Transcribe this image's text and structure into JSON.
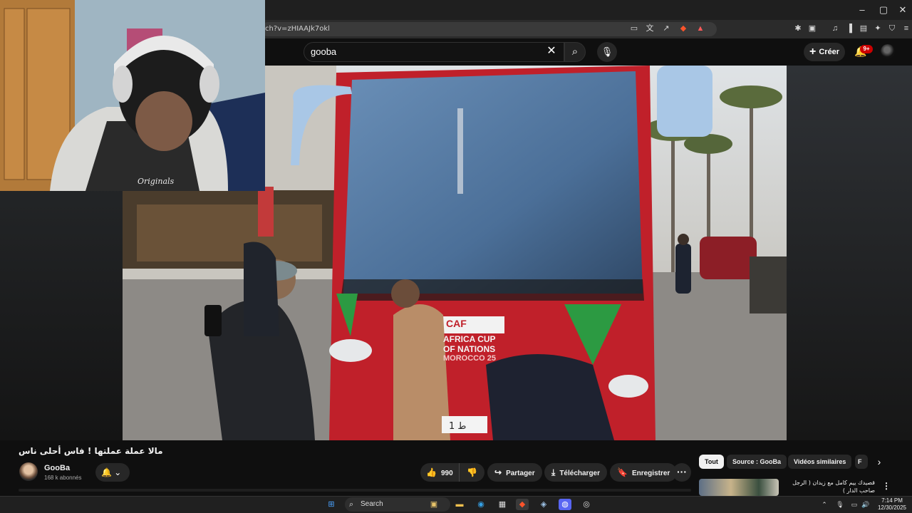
{
  "browser": {
    "url": "ch?v=zHIAAJk7okl",
    "window_controls": [
      "–",
      "▢",
      "✕"
    ]
  },
  "youtube_header": {
    "search_value": "gooba",
    "create_label": "Créer",
    "notification_badge": "9+"
  },
  "video": {
    "bus_text_caf": "CAF",
    "bus_text_africa": "AFRICA CUP",
    "bus_text_nations": "OF NATIONS",
    "bus_text_morocco": "MOROCCO 25",
    "webcam_shirt_text": "Originals"
  },
  "below_video": {
    "title": "مالا عملة عملتها ! فاس أحلى ناس",
    "channel_name": "GooBa",
    "subscribers": "168 k abonnés",
    "like_count": "990",
    "share_label": "Partager",
    "download_label": "Télécharger",
    "save_label": "Enregistrer",
    "more_label": "···"
  },
  "recommendations": {
    "chips": [
      "Tout",
      "Source : GooBa",
      "Vidéos similaires",
      "F"
    ],
    "first_title": "قصيدك ييم كامل مع زيدان ( الرجل صاحب الدار )"
  },
  "taskbar": {
    "search_placeholder": "Search",
    "time": "7:14 PM",
    "date": "12/30/2025"
  },
  "colors": {
    "youtube_bg": "#0f0f0f",
    "bus_red": "#c0202a",
    "notification_red": "#cc0000"
  }
}
